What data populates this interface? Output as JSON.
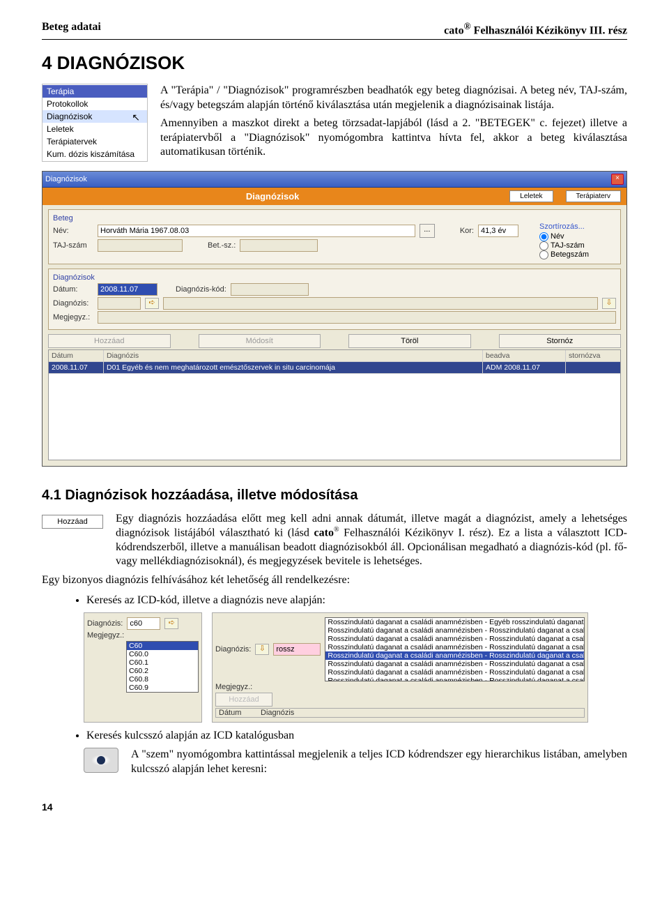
{
  "header": {
    "left": "Beteg adatai",
    "right_prefix": "cato",
    "right_suffix": " Felhasználói Kézikönyv III. rész"
  },
  "section": {
    "title": "4   DIAGNÓZISOK",
    "menu": {
      "items": [
        "Terápia",
        "Protokollok",
        "Diagnózisok",
        "Leletek",
        "Terápiatervek",
        "Kum. dózis kiszámítása"
      ]
    },
    "para1": "A \"Terápia\" / \"Diagnózisok\" programrészben beadhatók egy beteg diagnózisai. A beteg név, TAJ-szám, és/vagy betegszám alapján történő kiválasztása után megjelenik a diagnózisainak listája.",
    "para2": "Amennyiben a maszkot direkt a beteg törzsadat-lapjából (lásd a 2. \"BETEGEK\" c. fejezet) illetve a terápiatervből a \"Diagnózisok\" nyomógombra kattintva hívta fel, akkor a beteg kiválasztása automatikusan történik."
  },
  "screenshot": {
    "window_title": "Diagnózisok",
    "orange_title": "Diagnózisok",
    "btn_leletek": "Leletek",
    "btn_terapiaterv": "Terápiaterv",
    "beteg_label": "Beteg",
    "nev_label": "Név:",
    "nev_value": "Horváth Mária 1967.08.03",
    "kor_label": "Kor:",
    "kor_value": "41,3 év",
    "taj_label": "TAJ-szám",
    "betsz_label": "Bet.-sz.:",
    "sort_label": "Szortírozás...",
    "sort_opts": [
      "Név",
      "TAJ-szám",
      "Betegszám"
    ],
    "diag_label": "Diagnózisok",
    "datum_label": "Dátum:",
    "datum_value": "2008.11.07",
    "diagkod_label": "Diagnózis-kód:",
    "diagn_label": "Diagnózis:",
    "megj_label": "Megjegyz.:",
    "btns": {
      "hozzaad": "Hozzáad",
      "modosit": "Módosít",
      "torol": "Töröl",
      "stornoz": "Stornóz"
    },
    "table": {
      "headers": [
        "Dátum",
        "Diagnózis",
        "beadva",
        "stornózva"
      ],
      "row": {
        "datum": "2008.11.07",
        "diag": "D01 Egyéb és nem meghatározott emésztőszervek in situ carcinomája",
        "beadva": "ADM  2008.11.07",
        "storn": ""
      }
    }
  },
  "sub": {
    "title": "4.1   Diagnózisok hozzáadása, illetve módosítása",
    "btn_label": "Hozzáad",
    "para_a": "Egy diagnózis hozzáadása előtt meg kell adni annak dátumát, illetve magát a diagnózist, amely a lehetséges diagnózisok listájából választható ki (lásd ",
    "para_b": "cato",
    "para_c": " Felhasználói Kézikönyv I. rész). Ez a lista a választott ICD-kódrendszerből, illetve a manuálisan beadott diagnózisokból áll. Opcionálisan megadható a diagnózis-kód (pl. fő- vagy mellékdiagnózisoknál), és megjegyzések bevitele is lehetséges.",
    "para2": "Egy bizonyos diagnózis felhívásához két lehetőség áll rendelkezésre:",
    "bullet1": "Keresés az ICD-kód,  illetve a diagnózis neve alapján:",
    "bullet2": "Keresés kulcsszó alapján az ICD katalógusban",
    "eye_para": "A \"szem\" nyomógombra kattintással megjelenik a teljes ICD kódrendszer egy hierarchikus listában, amelyben kulcsszó alapján lehet keresni:"
  },
  "shotA": {
    "diag_label": "Diagnózis:",
    "diag_val": "c60",
    "megj_label": "Megjegyz.:",
    "list": [
      "C60",
      "C60.0",
      "C60.1",
      "C60.2",
      "C60.8",
      "C60.9"
    ]
  },
  "shotB": {
    "diag_label": "Diagnózis:",
    "diag_val": "rossz",
    "megj_label": "Megjegyz.:",
    "hozzaad": "Hozzáad",
    "datum_h": "Dátum",
    "diag_h": "Diagnózis",
    "list": [
      "Rosszindulatú daganat a családi anamnézisben - Egyéb rosszindulatú daganat a családban",
      "Rosszindulatú daganat a családi anamnézisben - Rosszindulatú daganat a családban k.m.n.",
      "Rosszindulatú daganat a családi anamnézisben - Rosszindulatú daganat a családban: emésztőrendszer",
      "Rosszindulatú daganat a családi anamnézisben - Rosszindulatú daganat a családban: emlő",
      "Rosszindulatú daganat a családi anamnézisben - Rosszindulatú daganat a családban: fehérvérűség",
      "Rosszindulatú daganat a családi anamnézisben - Rosszindulatú daganat a családban: húgyrendszer",
      "Rosszindulatú daganat a családi anamnézisben - Rosszindulatú daganat a családban: légzőrendszer",
      "Rosszindulatú daganat a családi anamnézisben - Rosszindulatú daganat a családban: mellkasi és egyéb légzőszervi"
    ],
    "hl_index": 4
  },
  "page_number": "14"
}
